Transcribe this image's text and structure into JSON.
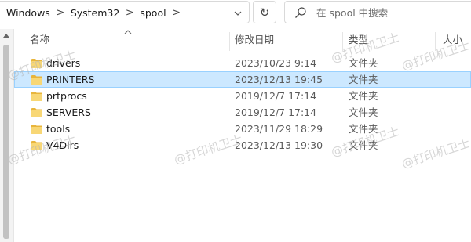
{
  "address_bar": {
    "crumbs": [
      "Windows",
      "System32",
      "spool"
    ],
    "separator": ">",
    "dropdown_glyph": "⌄",
    "refresh_glyph": "↻"
  },
  "search": {
    "placeholder": "在 spool 中搜索"
  },
  "columns": {
    "name": "名称",
    "date": "修改日期",
    "type": "类型",
    "size": "大小"
  },
  "files": [
    {
      "name": "drivers",
      "date": "2023/10/23 9:14",
      "type": "文件夹",
      "selected": false
    },
    {
      "name": "PRINTERS",
      "date": "2023/12/13 19:45",
      "type": "文件夹",
      "selected": true
    },
    {
      "name": "prtprocs",
      "date": "2019/12/7 17:14",
      "type": "文件夹",
      "selected": false
    },
    {
      "name": "SERVERS",
      "date": "2019/12/7 17:14",
      "type": "文件夹",
      "selected": false
    },
    {
      "name": "tools",
      "date": "2023/11/29 18:29",
      "type": "文件夹",
      "selected": false
    },
    {
      "name": "V4Dirs",
      "date": "2023/12/13 19:30",
      "type": "文件夹",
      "selected": false
    }
  ],
  "watermark": "@打印机卫士",
  "colors": {
    "selection_bg": "#cce8ff",
    "selection_border": "#99d1ff",
    "folder": "#f8d775",
    "folder_dark": "#e8b53c"
  }
}
